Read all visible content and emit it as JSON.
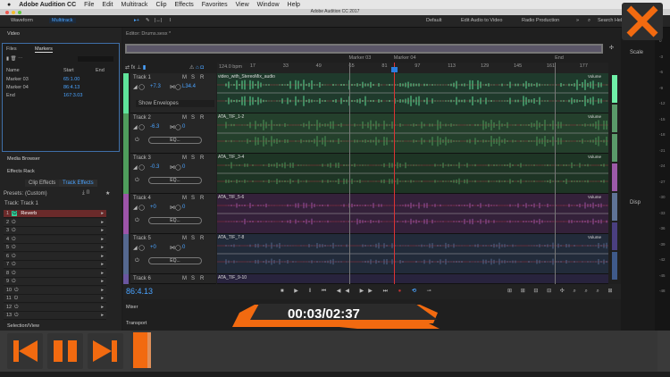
{
  "menubar": {
    "app": "Adobe Audition CC",
    "items": [
      "File",
      "Edit",
      "Multitrack",
      "Clip",
      "Effects",
      "Favorites",
      "View",
      "Window",
      "Help"
    ]
  },
  "title": "Adobe Audition CC 2017",
  "toolbar": {
    "waveform": "Waveform",
    "multitrack": "Multitrack",
    "workspaces": [
      "Default",
      "Edit Audio to Video",
      "Radio Production"
    ],
    "more": "»",
    "search": "Search Help"
  },
  "left": {
    "video": "Video",
    "files_tab": "Files",
    "markers_tab": "Markers",
    "cols": [
      "Name",
      "Start",
      "End"
    ],
    "markers": [
      {
        "name": "Marker 03",
        "start": "65:1.00"
      },
      {
        "name": "Marker 04",
        "start": "86:4.13"
      },
      {
        "name": "End",
        "start": "167:3.03"
      }
    ],
    "media_browser": "Media Browser",
    "effects_rack": "Effects Rack",
    "clip_effects": "Clip Effects",
    "track_effects": "Track Effects",
    "presets_label": "Presets:",
    "presets_value": "(Custom)",
    "track_label": "Track: Track 1",
    "rack": [
      "1",
      "2",
      "3",
      "4",
      "5",
      "6",
      "7",
      "8",
      "9",
      "10",
      "11",
      "12",
      "13"
    ],
    "rack_first": "Reverb",
    "selection": "Selection/View"
  },
  "editor": {
    "title": "Editor: Drums.sesx *",
    "bpm": "124.0 bpm",
    "ruler": [
      "17",
      "33",
      "49",
      "65",
      "81",
      "97",
      "113",
      "129",
      "145",
      "161",
      "177"
    ],
    "markers": [
      "Marker 03",
      "Marker 04",
      "End"
    ],
    "tracks": [
      {
        "name": "Track 1",
        "vol": "+7.3",
        "pan": "L34.4",
        "clip": "video_with_StereoMix_audio",
        "color": "#5fe39a",
        "lane": "#1f3a2c"
      },
      {
        "name": "Track 2",
        "vol": "-6.3",
        "pan": "0",
        "clip": "ATA_TIF_1-2",
        "color": "#4f9d5c",
        "lane": "#24402c"
      },
      {
        "name": "Track 3",
        "vol": "-0.3",
        "pan": "0",
        "clip": "ATA_TIF_3-4",
        "color": "#4f9d5c",
        "lane": "#1e3525"
      },
      {
        "name": "Track 4",
        "vol": "+0",
        "pan": "0",
        "clip": "ATA_TIF_5-6",
        "color": "#9c54a8",
        "lane": "#34213a"
      },
      {
        "name": "Track 5",
        "vol": "+0",
        "pan": "0",
        "clip": "ATA_TIF_7-8",
        "color": "#55688f",
        "lane": "#222b3a"
      },
      {
        "name": "Track 6",
        "vol": "",
        "pan": "",
        "clip": "ATA_TIF_9-10",
        "color": "#6a56a0",
        "lane": "#28233d"
      }
    ],
    "show_envelopes": "Show Envelopes",
    "eq": "EQ...",
    "volume": "Volume",
    "msr": [
      "M",
      "S",
      "R"
    ],
    "time": "86:4.13",
    "mixer": "Mixer",
    "transport": "Transport"
  },
  "right": {
    "scale": "Scale",
    "disp": "Disp",
    "db": [
      "0",
      "-3",
      "-6",
      "-9",
      "-12",
      "-15",
      "-18",
      "-21",
      "-24",
      "-27",
      "-30",
      "-33",
      "-36",
      "-39",
      "-42",
      "-45",
      "-48"
    ]
  },
  "player": {
    "time": "00:03/02:37",
    "progress": 0.02,
    "accent": "#f26a10"
  }
}
